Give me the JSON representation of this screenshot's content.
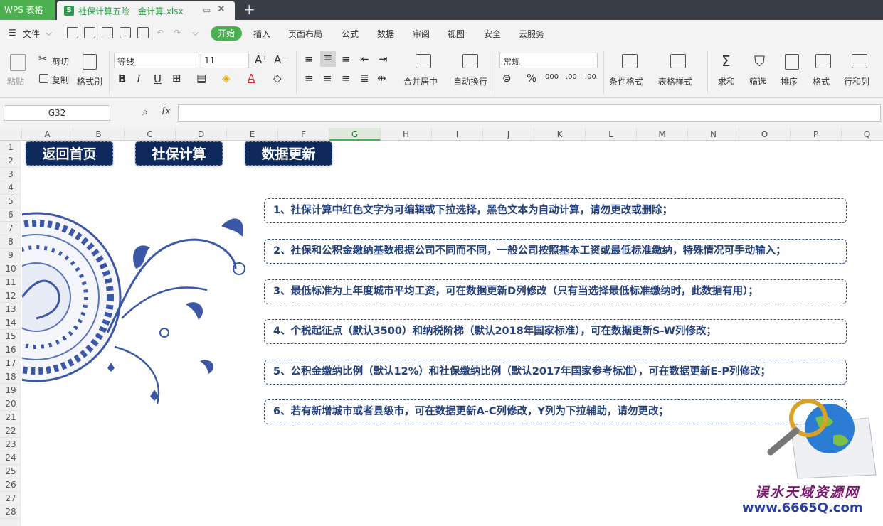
{
  "tabs": {
    "app": "WPS 表格",
    "file": "社保计算五险一金计算.xlsx",
    "new_tab": "+"
  },
  "menu": {
    "file": "文件",
    "items": [
      "开始",
      "插入",
      "页面布局",
      "公式",
      "数据",
      "审阅",
      "视图",
      "安全",
      "云服务"
    ]
  },
  "ribbon": {
    "paste": "粘贴",
    "cut": "剪切",
    "copy": "复制",
    "format_painter": "格式刷",
    "font_name": "等线",
    "font_size": "11",
    "bold": "B",
    "italic": "I",
    "underline": "U",
    "merge_center": "合并居中",
    "wrap": "自动换行",
    "number_format": "常规",
    "percent": "%",
    "thousands": "000",
    "inc_decimal": ".00",
    "dec_decimal": ".00",
    "cond_format": "条件格式",
    "table_style": "表格样式",
    "sum": "求和",
    "filter": "筛选",
    "sort": "排序",
    "format": "格式",
    "rowcol": "行和列"
  },
  "formula_bar": {
    "name_box": "G32",
    "fx": "fx",
    "value": ""
  },
  "columns": [
    "A",
    "B",
    "C",
    "D",
    "E",
    "F",
    "G",
    "H",
    "I",
    "J",
    "K",
    "L",
    "M",
    "N",
    "O",
    "P",
    "Q"
  ],
  "active_column": "G",
  "rows": [
    "1",
    "2",
    "3",
    "4",
    "5",
    "6",
    "7",
    "8",
    "9",
    "10",
    "11",
    "12",
    "13",
    "14",
    "15",
    "16",
    "17",
    "18",
    "19",
    "20",
    "21",
    "22",
    "23",
    "24",
    "25",
    "26",
    "27",
    "28"
  ],
  "buttons": {
    "home": "返回首页",
    "calc": "社保计算",
    "update": "数据更新"
  },
  "notes": [
    "1、社保计算中红色文字为可编辑或下拉选择，黑色文本为自动计算，请勿更改或删除；",
    "2、社保和公积金缴纳基数根据公司不同而不同，一般公司按照基本工资或最低标准缴纳，特殊情况可手动输入；",
    "3、最低标准为上年度城市平均工资，可在数据更新D列修改（只有当选择最低标准缴纳时，此数据有用）；",
    "4、个税起征点（默认3500）和纳税阶梯（默认2018年国家标准），可在数据更新S-W列修改；",
    "5、公积金缴纳比例（默认12%）和社保缴纳比例（默认2017年国家参考标准），可在数据更新E-P列修改；",
    "6、若有新增城市或者县级市，可在数据更新A-C列修改，Y列为下拉辅助，请勿更改；"
  ],
  "watermark": {
    "line1": "误水天域资源网",
    "line2": "www.6665Q.com"
  },
  "colors": {
    "accent": "#4caf50",
    "button_bg": "#0e2a5c",
    "note_text": "#23407a"
  }
}
